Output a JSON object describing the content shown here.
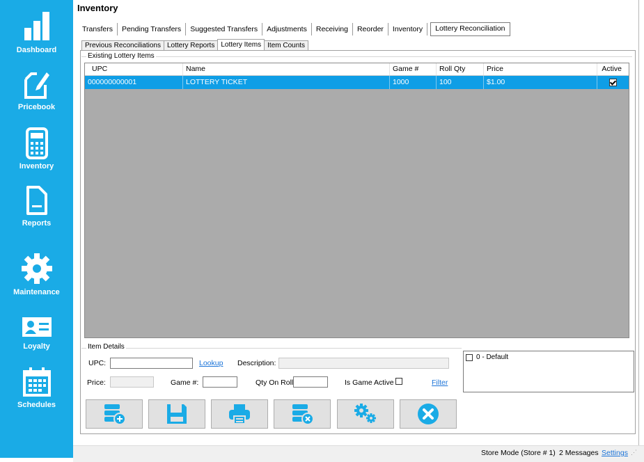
{
  "sidebar": {
    "items": [
      {
        "label": "Dashboard",
        "icon": "bar-chart-icon"
      },
      {
        "label": "Pricebook",
        "icon": "edit-document-icon"
      },
      {
        "label": "Inventory",
        "icon": "calculator-icon"
      },
      {
        "label": "Reports",
        "icon": "report-document-icon"
      },
      {
        "label": "Maintenance",
        "icon": "gear-icon"
      },
      {
        "label": "Loyalty",
        "icon": "id-card-icon"
      },
      {
        "label": "Schedules",
        "icon": "calendar-icon"
      }
    ],
    "color": "#1aabe6"
  },
  "page_title": "Inventory",
  "main_tabs": [
    "Transfers",
    "Pending Transfers",
    "Suggested Transfers",
    "Adjustments",
    "Receiving",
    "Reorder",
    "Inventory",
    "Lottery Reconciliation"
  ],
  "sub_tabs": [
    "Previous Reconciliations",
    "Lottery Reports",
    "Lottery Items",
    "Item Counts"
  ],
  "existing_group": {
    "label": "Existing Lottery Items",
    "columns": [
      "UPC",
      "Name",
      "Game #",
      "Roll Qty",
      "Price",
      "Active"
    ],
    "rows": [
      {
        "upc": "000000000001",
        "name": "LOTTERY TICKET",
        "game": "1000",
        "roll_qty": "100",
        "price": "$1.00",
        "active": true
      }
    ],
    "selection_color": "#0f9ee6"
  },
  "item_details": {
    "label": "Item Details",
    "upc_label": "UPC:",
    "lookup_link": "Lookup",
    "description_label": "Description:",
    "price_label": "Price:",
    "game_label": "Game #:",
    "qty_label": "Qty On Roll:",
    "active_label": "Is Game Active",
    "filter_link": "Filter"
  },
  "stores": [
    "0 - Default"
  ],
  "actions": {
    "add": "add-item-icon",
    "save": "save-icon",
    "print": "print-icon",
    "delete": "delete-item-icon",
    "settings": "gears-icon",
    "close": "close-icon",
    "icon_color": "#1aabe6"
  },
  "status": {
    "mode": "Store Mode (Store # 1)",
    "messages": "2 Messages",
    "settings_link": "Settings"
  }
}
